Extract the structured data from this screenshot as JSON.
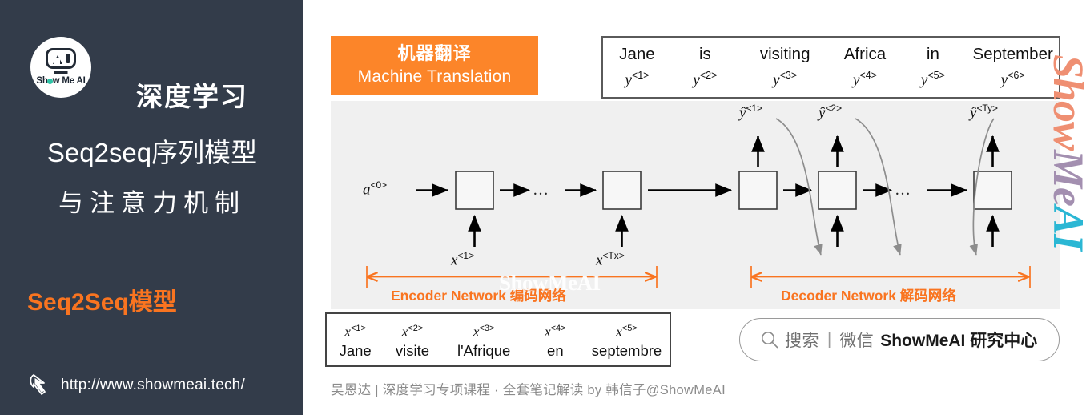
{
  "sidebar": {
    "logo": {
      "icon": "showmeai-robot-logo",
      "text_before": "Sh",
      "dot": "o",
      "text_after": "w Me AI"
    },
    "title_line1": "深度学习",
    "title_line2": "Seq2seq序列模型",
    "title_line3": "与注意力机制",
    "subtitle": "Seq2Seq模型",
    "cursor_icon": "mouse-cursor-icon",
    "url": "http://www.showmeai.tech/",
    "bg_color": "#333c4a",
    "accent_color": "#f97420"
  },
  "header": {
    "zh": "机器翻译",
    "en": "Machine Translation",
    "bg_color": "#fc8529"
  },
  "output_sentence": {
    "cells": [
      {
        "word": "Jane",
        "sym": "y",
        "idx": "<1>"
      },
      {
        "word": "is",
        "sym": "y",
        "idx": "<2>"
      },
      {
        "word": "visiting",
        "sym": "y",
        "idx": "<3>"
      },
      {
        "word": "Africa",
        "sym": "y",
        "idx": "<4>"
      },
      {
        "word": "in",
        "sym": "y",
        "idx": "<5>"
      },
      {
        "word": "September",
        "sym": "y",
        "idx": "<6>"
      }
    ]
  },
  "diagram": {
    "watermark": "ShowMeAI",
    "bg_color": "#f0f0f0",
    "initial_state": {
      "sym": "a",
      "idx": "<0>"
    },
    "encoder_inputs": [
      {
        "sym": "x",
        "idx": "<1>"
      },
      {
        "sym": "x",
        "idx": "<Tx>"
      }
    ],
    "decoder_outputs": [
      {
        "sym": "ŷ",
        "idx": "<1>"
      },
      {
        "sym": "ŷ",
        "idx": "<2>"
      },
      {
        "sym": "ŷ",
        "idx": "<Ty>"
      }
    ],
    "ellipsis": "…",
    "encoder_range_label": "Encoder Network 编码网络",
    "decoder_range_label": "Decoder Network 解码网络",
    "range_color": "#f97420"
  },
  "input_sentence": {
    "cells": [
      {
        "sym": "x",
        "idx": "<1>",
        "word": "Jane"
      },
      {
        "sym": "x",
        "idx": "<2>",
        "word": "visite"
      },
      {
        "sym": "x",
        "idx": "<3>",
        "word": "l'Afrique"
      },
      {
        "sym": "x",
        "idx": "<4>",
        "word": "en"
      },
      {
        "sym": "x",
        "idx": "<5>",
        "word": "septembre"
      }
    ]
  },
  "search": {
    "icon": "search-icon",
    "placeholder": "搜索",
    "divider": "|",
    "channel": "微信",
    "brand": "ShowMeAI 研究中心"
  },
  "footer": {
    "text": "吴恩达 | 深度学习专项课程 · 全套笔记解读  by 韩信子@ShowMeAI"
  },
  "watermark_vertical": {
    "part1": "Show",
    "part2": "Me",
    "part3": "AI",
    "colors": [
      "#ef8f72",
      "#a38fb0",
      "#2bb7d4"
    ]
  }
}
